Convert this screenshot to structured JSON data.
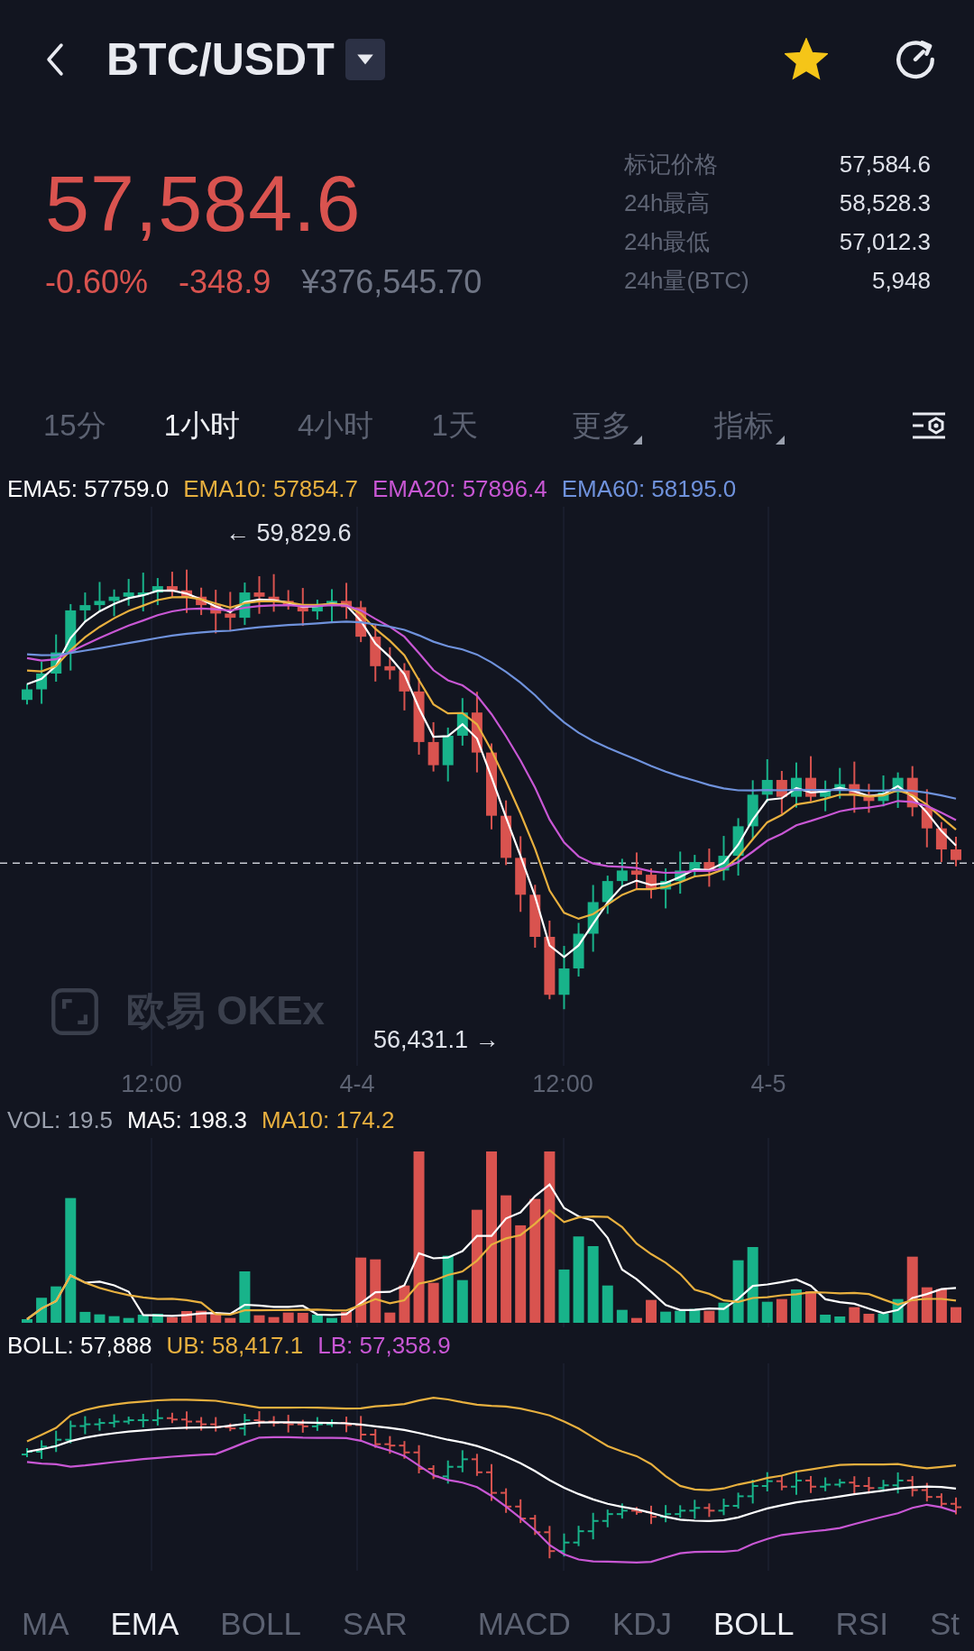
{
  "header": {
    "title": "BTC/USDT",
    "favorite": true
  },
  "ticker": {
    "price": "57,584.6",
    "change_percent": "-0.60%",
    "change": "-348.9",
    "cny_price": "¥376,545.70"
  },
  "stats": [
    {
      "label": "标记价格",
      "value": "57,584.6"
    },
    {
      "label": "24h最高",
      "value": "58,528.3"
    },
    {
      "label": "24h最低",
      "value": "57,012.3"
    },
    {
      "label": "24h量(BTC)",
      "value": "5,948"
    }
  ],
  "intervals": [
    {
      "label": "15分",
      "selected": false,
      "kind": "tab"
    },
    {
      "label": "1小时",
      "selected": true,
      "kind": "tab"
    },
    {
      "label": "4小时",
      "selected": false,
      "kind": "tab"
    },
    {
      "label": "1天",
      "selected": false,
      "kind": "tab"
    },
    {
      "label": "更多",
      "selected": false,
      "kind": "menu"
    },
    {
      "label": "指标",
      "selected": false,
      "kind": "menu"
    }
  ],
  "main_chart": {
    "legend": [
      {
        "text": "EMA5: 57759.0",
        "color": "#ffffff"
      },
      {
        "text": "EMA10: 57854.7",
        "color": "#e8b03f"
      },
      {
        "text": "EMA20: 57896.4",
        "color": "#c857d4"
      },
      {
        "text": "EMA60: 58195.0",
        "color": "#6f92dc"
      }
    ],
    "high_label": "← 59,829.6",
    "low_label": "56,431.1 →",
    "watermark": "欧易 OKEx",
    "x_labels": [
      "12:00",
      "4-4",
      "12:00",
      "4-5"
    ]
  },
  "volume_chart": {
    "legend": [
      {
        "text": "VOL: 19.5",
        "color": "#9aa0ad"
      },
      {
        "text": "MA5: 198.3",
        "color": "#ffffff"
      },
      {
        "text": "MA10: 174.2",
        "color": "#e8b03f"
      }
    ]
  },
  "boll_chart": {
    "legend": [
      {
        "text": "BOLL: 57,888",
        "color": "#ffffff"
      },
      {
        "text": "UB: 58,417.1",
        "color": "#e8b03f"
      },
      {
        "text": "LB: 57,358.9",
        "color": "#c857d4"
      }
    ]
  },
  "indicator_tabs": {
    "main": [
      {
        "label": "MA",
        "selected": false
      },
      {
        "label": "EMA",
        "selected": true
      },
      {
        "label": "BOLL",
        "selected": false
      },
      {
        "label": "SAR",
        "selected": false
      }
    ],
    "sub": [
      {
        "label": "MACD",
        "selected": false
      },
      {
        "label": "KDJ",
        "selected": false
      },
      {
        "label": "BOLL",
        "selected": true
      },
      {
        "label": "RSI",
        "selected": false
      },
      {
        "label": "St",
        "selected": false
      }
    ]
  }
}
